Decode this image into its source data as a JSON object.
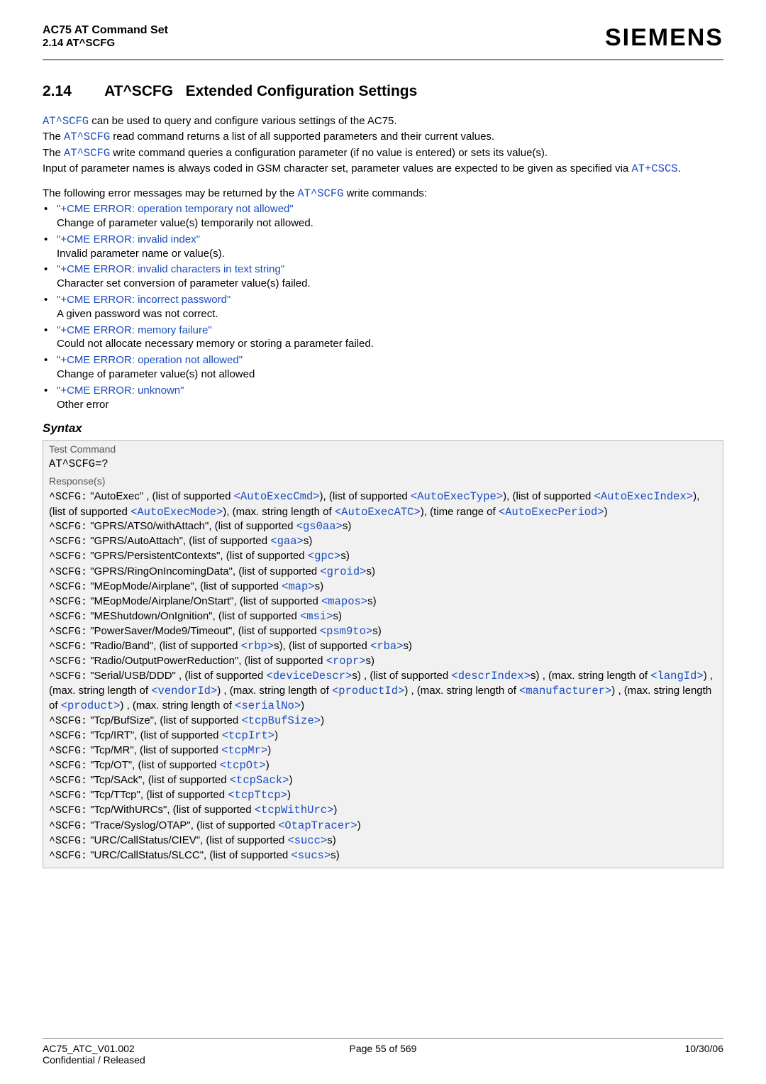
{
  "header": {
    "doc_title": "AC75 AT Command Set",
    "section_ref": "2.14 AT^SCFG",
    "brand": "SIEMENS"
  },
  "section": {
    "number": "2.14",
    "title_cmd": "AT^SCFG",
    "title_rest": "Extended Configuration Settings"
  },
  "intro": {
    "l1a": "AT^SCFG",
    "l1b": " can be used to query and configure various settings of the AC75.",
    "l2a": "The ",
    "l2b": "AT^SCFG",
    "l2c": " read command returns a list of all supported parameters and their current values.",
    "l3a": "The ",
    "l3b": "AT^SCFG",
    "l3c": " write command queries a configuration parameter (if no value is entered) or sets its value(s).",
    "l4": "Input of parameter names is always coded in GSM character set, parameter values are expected to be given as specified via ",
    "l4b": "AT+CSCS",
    "l4c": "."
  },
  "errintro_a": "The following error messages may be returned by the ",
  "errintro_b": "AT^SCFG",
  "errintro_c": " write commands:",
  "errors": [
    {
      "msg": "\"+CME ERROR: operation temporary not allowed\"",
      "desc": "Change of parameter value(s) temporarily not allowed."
    },
    {
      "msg": "\"+CME ERROR: invalid index\"",
      "desc": "Invalid parameter name or value(s)."
    },
    {
      "msg": "\"+CME ERROR: invalid characters in text string\"",
      "desc": "Character set conversion of parameter value(s) failed."
    },
    {
      "msg": "\"+CME ERROR: incorrect password\"",
      "desc": "A given password was not correct."
    },
    {
      "msg": "\"+CME ERROR: memory failure\"",
      "desc": "Could not allocate necessary memory or storing a parameter failed."
    },
    {
      "msg": "\"+CME ERROR: operation not allowed\"",
      "desc": "Change of parameter value(s) not allowed"
    },
    {
      "msg": "\"+CME ERROR: unknown\"",
      "desc": "Other error"
    }
  ],
  "syntax_label": "Syntax",
  "box": {
    "test_label": "Test Command",
    "test_cmd": "AT^SCFG=?",
    "resp_label": "Response(s)"
  },
  "resp": {
    "prefix": "^SCFG:",
    "t1": "\"AutoExec\" , (list of supported ",
    "p1": "<AutoExecCmd>",
    "t2": "), (list of supported ",
    "p2": "<AutoExecType>",
    "t3": "), (list of supported ",
    "p3": "<AutoExecIndex>",
    "t4": "), (list of supported ",
    "p4": "<AutoExecMode>",
    "t5": "), (max. string length of ",
    "p5": "<AutoExecATC>",
    "t6": "), (time range of ",
    "p6": "<AutoExecPeriod>",
    "t7": ")",
    "gprs1_a": "\"GPRS/ATS0/withAttach\", (list of supported ",
    "gprs1_p": "<gs0aa>",
    "tail_s": "s)",
    "gprs2_a": "\"GPRS/AutoAttach\", (list of supported ",
    "gprs2_p": "<gaa>",
    "gprs3_a": "\"GPRS/PersistentContexts\", (list of supported ",
    "gprs3_p": "<gpc>",
    "gprs4_a": "\"GPRS/RingOnIncomingData\", (list of supported ",
    "gprs4_p": "<groid>",
    "meop1_a": "\"MEopMode/Airplane\", (list of supported ",
    "meop1_p": "<map>",
    "meop2_a": "\"MEopMode/Airplane/OnStart\", (list of supported ",
    "meop2_p": "<mapos>",
    "mesh_a": "\"MEShutdown/OnIgnition\", (list of supported ",
    "mesh_p": "<msi>",
    "pwr_a": "\"PowerSaver/Mode9/Timeout\", (list of supported ",
    "pwr_p": "<psm9to>",
    "rb_a": "\"Radio/Band\", (list of supported ",
    "rb_p1": "<rbp>",
    "rb_mid": "s), (list of supported ",
    "rb_p2": "<rba>",
    "ropr_a": "\"Radio/OutputPowerReduction\", (list of supported ",
    "ropr_p": "<ropr>",
    "ser_a": "\"Serial/USB/DDD\" , (list of supported ",
    "ser_p1": "<deviceDescr>",
    "ser_mid1": "s) , (list of supported ",
    "ser_p2": "<descrIndex>",
    "ser_mid2": "s) , (max. string length of ",
    "ser_p3": "<langId>",
    "ser_mid3": ") , (max. string length of ",
    "ser_p4": "<vendorId>",
    "ser_mid4": ") , (max. string length of ",
    "ser_p5": "<productId>",
    "ser_mid5": ") , (max. string length of ",
    "ser_p6": "<manufacturer>",
    "ser_mid6": ") , (max. string length of ",
    "ser_p7": "<product>",
    "ser_mid7": ") , (max. string length of ",
    "ser_p8": "<serialNo>",
    "ser_end": ")",
    "tcpbuf_a": "\"Tcp/BufSize\", (list of supported ",
    "tcpbuf_p": "<tcpBufSize>",
    "tcpirt_a": "\"Tcp/IRT\", (list of supported ",
    "tcpirt_p": "<tcpIrt>",
    "tcpmr_a": "\"Tcp/MR\", (list of supported ",
    "tcpmr_p": "<tcpMr>",
    "tcpot_a": "\"Tcp/OT\", (list of supported ",
    "tcpot_p": "<tcpOt>",
    "tcpsack_a": "\"Tcp/SAck\", (list of supported ",
    "tcpsack_p": "<tcpSack>",
    "tcpttcp_a": "\"Tcp/TTcp\", (list of supported ",
    "tcpttcp_p": "<tcpTtcp>",
    "tcpurc_a": "\"Tcp/WithURCs\", (list of supported ",
    "tcpurc_p": "<tcpWithUrc>",
    "tail_p": ")",
    "trace_a": "\"Trace/Syslog/OTAP\", (list of supported ",
    "trace_p": "<OtapTracer>",
    "urc1_a": "\"URC/CallStatus/CIEV\", (list of supported ",
    "urc1_p": "<succ>",
    "urc2_a": "\"URC/CallStatus/SLCC\", (list of supported ",
    "urc2_p": "<sucs>"
  },
  "footer": {
    "left1": "AC75_ATC_V01.002",
    "left2": "Confidential / Released",
    "center": "Page 55 of 569",
    "right": "10/30/06"
  }
}
